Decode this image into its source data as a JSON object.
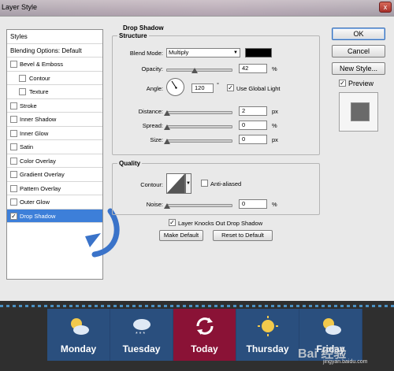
{
  "window": {
    "title": "Layer Style",
    "close": "x"
  },
  "left_panel": {
    "items": [
      {
        "label": "Styles",
        "checkbox": false
      },
      {
        "label": "Blending Options: Default",
        "checkbox": false
      },
      {
        "label": "Bevel & Emboss",
        "checkbox": true,
        "checked": false
      },
      {
        "label": "Contour",
        "checkbox": true,
        "checked": false,
        "indent": true
      },
      {
        "label": "Texture",
        "checkbox": true,
        "checked": false,
        "indent": true
      },
      {
        "label": "Stroke",
        "checkbox": true,
        "checked": false
      },
      {
        "label": "Inner Shadow",
        "checkbox": true,
        "checked": false
      },
      {
        "label": "Inner Glow",
        "checkbox": true,
        "checked": false
      },
      {
        "label": "Satin",
        "checkbox": true,
        "checked": false
      },
      {
        "label": "Color Overlay",
        "checkbox": true,
        "checked": false
      },
      {
        "label": "Gradient Overlay",
        "checkbox": true,
        "checked": false
      },
      {
        "label": "Pattern Overlay",
        "checkbox": true,
        "checked": false
      },
      {
        "label": "Outer Glow",
        "checkbox": true,
        "checked": false
      },
      {
        "label": "Drop Shadow",
        "checkbox": true,
        "checked": true,
        "selected": true
      }
    ]
  },
  "drop_shadow": {
    "title": "Drop Shadow",
    "structure": {
      "legend": "Structure",
      "blend_mode_label": "Blend Mode:",
      "blend_mode_value": "Multiply",
      "shadow_color": "#000000",
      "opacity_label": "Opacity:",
      "opacity_value": "42",
      "opacity_unit": "%",
      "angle_label": "Angle:",
      "angle_value": "120",
      "angle_unit": "°",
      "use_global_light_label": "Use Global Light",
      "use_global_light_checked": true,
      "distance_label": "Distance:",
      "distance_value": "2",
      "distance_unit": "px",
      "spread_label": "Spread:",
      "spread_value": "0",
      "spread_unit": "%",
      "size_label": "Size:",
      "size_value": "0",
      "size_unit": "px"
    },
    "quality": {
      "legend": "Quality",
      "contour_label": "Contour:",
      "anti_aliased_label": "Anti-aliased",
      "anti_aliased_checked": false,
      "noise_label": "Noise:",
      "noise_value": "0",
      "noise_unit": "%"
    },
    "knockout_label": "Layer Knocks Out Drop Shadow",
    "knockout_checked": true,
    "make_default": "Make Default",
    "reset_default": "Reset to Default"
  },
  "right": {
    "ok": "OK",
    "cancel": "Cancel",
    "new_style": "New Style...",
    "preview_label": "Preview",
    "preview_checked": true
  },
  "weather": {
    "days": [
      {
        "name": "Monday",
        "icon": "sun-cloud-icon"
      },
      {
        "name": "Tuesday",
        "icon": "snow-cloud-icon"
      },
      {
        "name": "Today",
        "icon": "refresh-icon",
        "active": true
      },
      {
        "name": "Thursday",
        "icon": "sun-icon"
      },
      {
        "name": "Friday",
        "icon": "sun-cloud-icon"
      }
    ]
  },
  "watermark": {
    "text": "Bai 经验",
    "url": "jingyan.baidu.com"
  }
}
